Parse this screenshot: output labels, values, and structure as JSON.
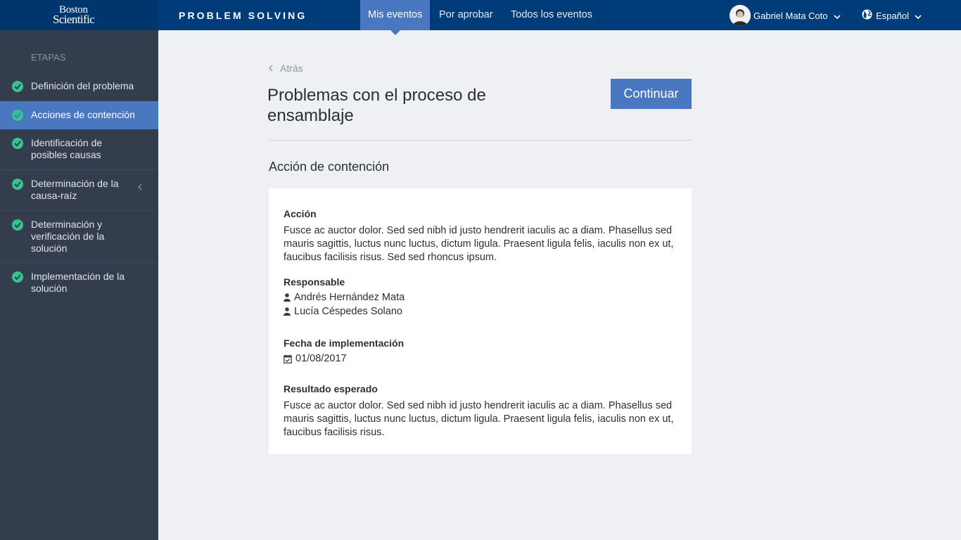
{
  "header": {
    "logo": {
      "line1": "Boston",
      "line2": "Scientific"
    },
    "app_title": "PROBLEM SOLVING",
    "tabs": [
      {
        "label": "Mis eventos",
        "active": true
      },
      {
        "label": "Por aprobar",
        "active": false
      },
      {
        "label": "Todos los eventos",
        "active": false
      }
    ],
    "user": {
      "name": "Gabriel Mata Coto",
      "avatar_icon": "user-avatar"
    },
    "language": {
      "label": "Español",
      "icon": "globe-icon"
    }
  },
  "sidebar": {
    "heading": "ETAPAS",
    "items": [
      {
        "label": "Definición del problema",
        "status_icon": "check-circle-icon",
        "active": false
      },
      {
        "label": "Acciones de contención",
        "status_icon": "check-circle-icon",
        "active": true
      },
      {
        "label": "Identificación de posibles causas",
        "status_icon": "check-circle-icon",
        "active": false
      },
      {
        "label": "Determinación de la causa-raíz",
        "status_icon": "check-circle-icon",
        "active": false,
        "has_chevron": true
      },
      {
        "label": "Determinación y verificación de la solución",
        "status_icon": "check-circle-icon",
        "active": false
      },
      {
        "label": "Implementación de la solución",
        "status_icon": "check-circle-icon",
        "active": false
      }
    ]
  },
  "main": {
    "back_label": "Atrás",
    "title": "Problemas con el proceso de ensamblaje",
    "continue_label": "Continuar",
    "section_title": "Acción de contención",
    "card": {
      "action_label": "Acción",
      "action_text": "Fusce ac auctor dolor. Sed sed nibh id justo hendrerit iaculis ac a diam. Phasellus sed mauris sagittis, luctus nunc luctus, dictum ligula. Praesent ligula felis, iaculis non ex ut, faucibus facilisis risus. Sed sed rhoncus ipsum.",
      "responsible_label": "Responsable",
      "responsibles": [
        "Andrés Hernández Mata",
        "Lucía Céspedes Solano"
      ],
      "date_label": "Fecha de implementación",
      "date_value": "01/08/2017",
      "result_label": "Resultado esperado",
      "result_text": "Fusce ac auctor dolor. Sed sed nibh id justo hendrerit iaculis ac a diam. Phasellus sed mauris sagittis, luctus nunc luctus, dictum ligula. Praesent ligula felis, iaculis non ex ut, faucibus facilisis risus."
    }
  },
  "colors": {
    "header": "#003b7a",
    "accent": "#4a78c0",
    "sidebar": "#333d4d",
    "success": "#35c48e",
    "background": "#eef0f4"
  }
}
